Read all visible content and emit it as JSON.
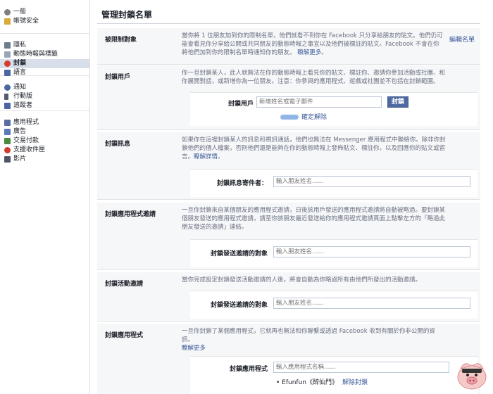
{
  "sidebar": {
    "groups": [
      [
        {
          "label": "一般",
          "icon": "gear-icon",
          "color": "#7f7f7f"
        },
        {
          "label": "帳號安全",
          "icon": "shield-icon",
          "color": "#d9a93a"
        }
      ],
      [
        {
          "label": "隱私",
          "icon": "lock-icon",
          "color": "#6d7b8f"
        },
        {
          "label": "動態時報與標籤",
          "icon": "timeline-icon",
          "color": "#9aa5b8"
        },
        {
          "label": "封鎖",
          "icon": "block-icon",
          "color": "#d63b2b",
          "active": true
        },
        {
          "label": "語言",
          "icon": "language-icon",
          "color": "#4b67a3"
        }
      ],
      [
        {
          "label": "通知",
          "icon": "globe-icon",
          "color": "#4b67a3"
        },
        {
          "label": "行動版",
          "icon": "phone-icon",
          "color": "#555e6d"
        },
        {
          "label": "追蹤者",
          "icon": "rss-icon",
          "color": "#4b67a3"
        }
      ],
      [
        {
          "label": "應用程式",
          "icon": "apps-icon",
          "color": "#5b6ea3"
        },
        {
          "label": "廣告",
          "icon": "ads-icon",
          "color": "#5b78b8"
        },
        {
          "label": "交易付款",
          "icon": "payment-icon",
          "color": "#4d8a3e"
        },
        {
          "label": "支援收件匣",
          "icon": "support-icon",
          "color": "#d23a2a"
        },
        {
          "label": "影片",
          "icon": "video-icon",
          "color": "#4e5665"
        }
      ]
    ]
  },
  "page_title": "管理封鎖名單",
  "sections": {
    "restricted": {
      "label": "被限制對象",
      "desc": "當你將 1 位朋友加到你的限制名單，他們就看不到你在 Facebook 只分享給朋友的貼文。他們仍可能會看見你分享給公開或共同朋友的動態時報之事宜以及他們被標註的貼文。Facebook 不會在你將他們加到你的限制名單時通知你的朋友。",
      "link": "瞭解更多",
      "edit": "編輯名單"
    },
    "block_users": {
      "label": "封鎖用戶",
      "desc": "你一旦封鎖某人，此人就無法在你的動態時報上看見你的貼文、標註你、邀請你參加活動或社團、和你展開對話，或新增你為一位朋友。注意：你參與的應用程式、遊戲或社團並不包括在封鎖範圍。",
      "field_label": "封鎖用戶",
      "placeholder": "新增姓名或電子郵件",
      "button": "封鎖",
      "blocked_action": "確定解除"
    },
    "block_messages": {
      "label": "封鎖訊息",
      "desc": "如果你在這裡封鎖某人的訊息和視訊通話，他們也無法在 Messenger 應用程式中聯絡你。除非你封鎖他們的個人檔案，否則他們還是能夠在你的動態時報上發佈貼文、標註你，以及回應你的貼文或留言。",
      "link": "瞭解詳情",
      "field_label": "封鎖訊息寄件者：",
      "placeholder": "輸入朋友姓名……"
    },
    "block_app_invites": {
      "label": "封鎖應用程式邀請",
      "desc": "一旦你封鎖來自某個朋友的應用程式邀請，日後該用戶發送的應用程式邀請將自動被略過。要封鎖某個朋友發送的應用程式邀請，請至你該朋友最近發送給你的應用程式邀請頁面上點擊左方的「略過此朋友發送的邀請」連結。",
      "field_label": "封鎖發送邀請的對象",
      "placeholder": "輸入朋友姓名……"
    },
    "block_event_invites": {
      "label": "封鎖活動邀請",
      "desc": "當你完成設定封鎖發送活動邀請的人後，將會自動為你略過所有由他們所發出的活動邀請。",
      "field_label": "封鎖發送邀請的對象",
      "placeholder": "輸入朋友姓名……"
    },
    "block_apps": {
      "label": "封鎖應用程式",
      "desc": "一旦你封鎖了某個應用程式，它就再也無法和你聯繫或透過 Facebook 收到有關於你非公開的資訊。",
      "link": "瞭解更多",
      "field_label": "封鎖應用程式",
      "placeholder": "輸入應用程式名稱……",
      "blocked_app": "Efunfun《醉仙門》",
      "blocked_action": "解除封鎖"
    }
  }
}
